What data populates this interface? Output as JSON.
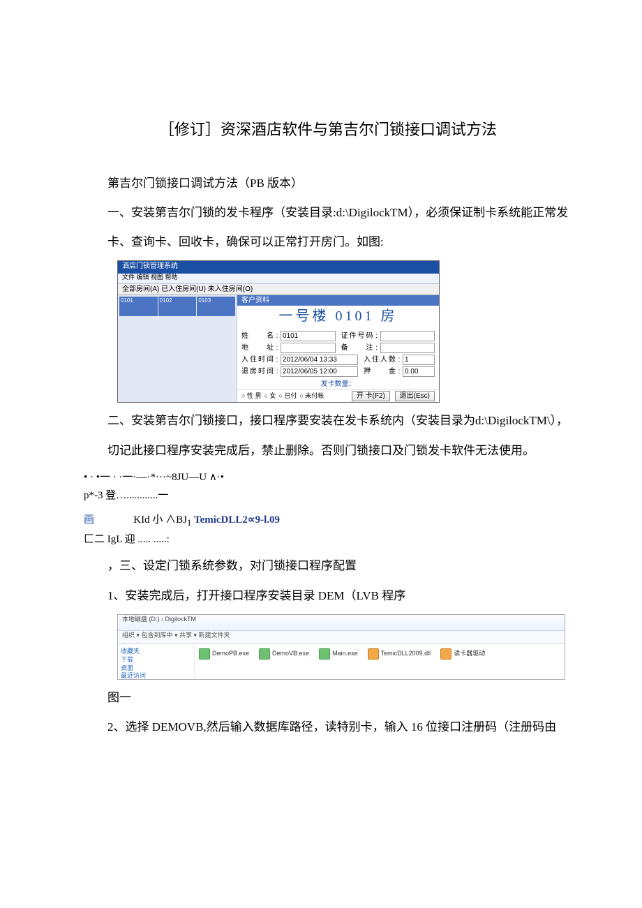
{
  "title": "［修订］资深酒店软件与第吉尔门锁接口调试方法",
  "paragraphs": {
    "p1": "第吉尔门锁接口调试方法（PB 版本）",
    "p2": "一、安装第吉尔门锁的发卡程序（安装目录:d:\\DigilockTM），必须保证制卡系统能正常发",
    "p3": "卡、查询卡、回收卡，确保可以正常打开房门。如图:",
    "p4": "二、安装第吉尔门锁接口，接口程序要安装在发卡系统内（安装目录为d:\\DigilockTM\\），",
    "p5": "切记此接口程序安装完成后，禁止删除。否则门锁接口及门锁发卡软件无法使用。",
    "frag1": "• · •一 · ·一·—·*···~8JU—U ∧·•",
    "frag2": "p*-3 登…............一",
    "frag3_pre": "画",
    "frag3_b": "KId 小 ∧BJ",
    "frag3_sub": "1",
    "frag3_bold": "TemicDLL2∝9-l.09",
    "frag4": "匚二 IgL 迎 ..... .....:",
    "p6": "，三、设定门锁系统参数，对门锁接口程序配置",
    "p7": "1、安装完成后，打开接口程序安装目录 DEM（LVB 程序",
    "tu1": "图一",
    "p8": "2、选择 DEMOVB,然后输入数据库路径，读特别卡，输入 16 位接口注册码（注册码由"
  },
  "shot1": {
    "titlebar": "酒店门锁管理系统",
    "menubar": "文件 编辑 视图 帮助",
    "tabs": "全部房间(A) 已入住房间(U) 未入住房间(O)",
    "cards": [
      "0101",
      "0102",
      "0103"
    ],
    "caption": "客户资料",
    "roomtitle": "一号楼 0101 房",
    "form": {
      "name_lbl": "姓    名",
      "name_val": "0101",
      "id_lbl": "证件号码",
      "addr_lbl": "地    址",
      "remark_lbl": "备    注",
      "checkin_lbl": "入住时间",
      "checkin_val": "2012/06/04 13:33",
      "num_lbl": "入住人数",
      "num_val": "1",
      "checkout_lbl": "退房时间",
      "checkout_val": "2012/06/05 12:00",
      "deposit_lbl": "押    金",
      "deposit_val": "0.00"
    },
    "qty": "发卡数量：",
    "radios": [
      "性 男",
      "女",
      "已付",
      "未付帐"
    ],
    "btn_save": "开 卡(F2)",
    "btn_exit": "退出(Esc)"
  },
  "shot2": {
    "top": "本地磁盘 (D:) › DigilockTM",
    "toolbar": "组织 ▾   包含到库中 ▾   共享 ▾   新建文件夹",
    "side": [
      "收藏夹",
      "下载",
      "桌面",
      "最近访问"
    ],
    "files": [
      "DemoPB.exe",
      "DemoVB.exe",
      "Main.exe",
      "TemicDLL2009.dll",
      "读卡器驱动"
    ]
  }
}
